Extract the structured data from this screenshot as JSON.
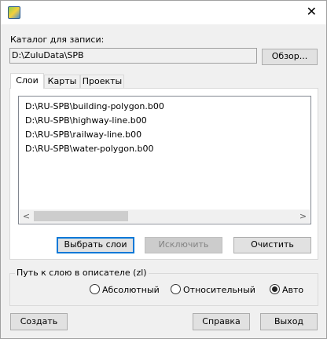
{
  "window": {
    "close_glyph": "✕"
  },
  "folder": {
    "label": "Каталог для записи:",
    "value": "D:\\ZuluData\\SPB",
    "browse_label": "Обзор..."
  },
  "tabs": [
    {
      "label": "Слои",
      "active": true
    },
    {
      "label": "Карты",
      "active": false
    },
    {
      "label": "Проекты",
      "active": false
    }
  ],
  "layers": {
    "items": [
      "D:\\RU-SPB\\building-polygon.b00",
      "D:\\RU-SPB\\highway-line.b00",
      "D:\\RU-SPB\\railway-line.b00",
      "D:\\RU-SPB\\water-polygon.b00"
    ],
    "scroll_left": "<",
    "scroll_right": ">",
    "select_label": "Выбрать слои",
    "exclude_label": "Исключить",
    "clear_label": "Очистить"
  },
  "path_group": {
    "title": "Путь к слою в описателе (zl)",
    "options": [
      {
        "label": "Абсолютный",
        "selected": false
      },
      {
        "label": "Относительный",
        "selected": false
      },
      {
        "label": "Авто",
        "selected": true
      }
    ]
  },
  "footer": {
    "create_label": "Создать",
    "help_label": "Справка",
    "exit_label": "Выход"
  }
}
